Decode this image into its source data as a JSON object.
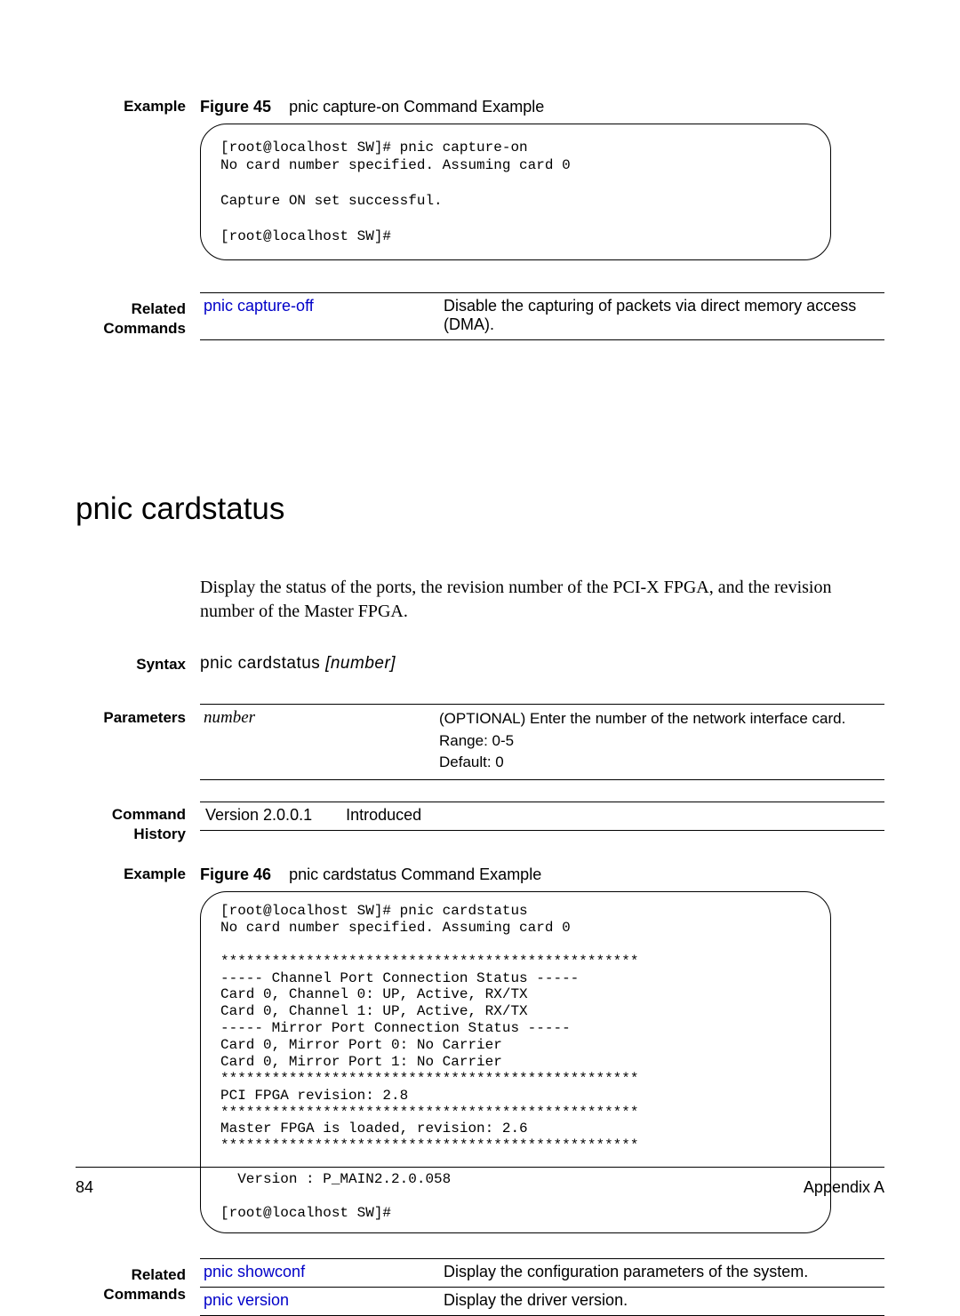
{
  "example1": {
    "label": "Example",
    "figure_label": "Figure 45",
    "figure_caption": "pnic capture-on Command Example",
    "terminal": "[root@localhost SW]# pnic capture-on\nNo card number specified. Assuming card 0\n\nCapture ON set successful.\n\n[root@localhost SW]#"
  },
  "related1": {
    "label_line1": "Related",
    "label_line2": "Commands",
    "rows": [
      {
        "cmd": "pnic capture-off",
        "desc": "Disable the capturing of packets via direct memory access (DMA)."
      }
    ]
  },
  "section_title": "pnic cardstatus",
  "section_desc": "Display the status of the ports, the revision number of the PCI-X FPGA, and the revision number of the Master FPGA.",
  "syntax": {
    "label": "Syntax",
    "cmd": "pnic cardstatus",
    "param": "[number]"
  },
  "parameters": {
    "label": "Parameters",
    "rows": [
      {
        "name": "number",
        "desc": "(OPTIONAL) Enter the number of the network interface card.\nRange: 0-5\nDefault: 0"
      }
    ]
  },
  "history": {
    "label_line1": "Command",
    "label_line2": "History",
    "version": "Version 2.0.0.1",
    "note": "Introduced"
  },
  "example2": {
    "label": "Example",
    "figure_label": "Figure 46",
    "figure_caption": "pnic cardstatus Command Example",
    "terminal": "[root@localhost SW]# pnic cardstatus\nNo card number specified. Assuming card 0\n\n*************************************************\n----- Channel Port Connection Status -----\nCard 0, Channel 0: UP, Active, RX/TX\nCard 0, Channel 1: UP, Active, RX/TX\n----- Mirror Port Connection Status -----\nCard 0, Mirror Port 0: No Carrier\nCard 0, Mirror Port 1: No Carrier\n*************************************************\nPCI FPGA revision: 2.8\n*************************************************\nMaster FPGA is loaded, revision: 2.6\n*************************************************\n\n  Version : P_MAIN2.2.0.058\n\n[root@localhost SW]#"
  },
  "related2": {
    "label_line1": "Related",
    "label_line2": "Commands",
    "rows": [
      {
        "cmd": "pnic showconf",
        "desc": "Display the configuration parameters of the system."
      },
      {
        "cmd": "pnic version",
        "desc": "Display the driver version."
      }
    ]
  },
  "footer": {
    "page": "84",
    "appendix": "Appendix A"
  }
}
